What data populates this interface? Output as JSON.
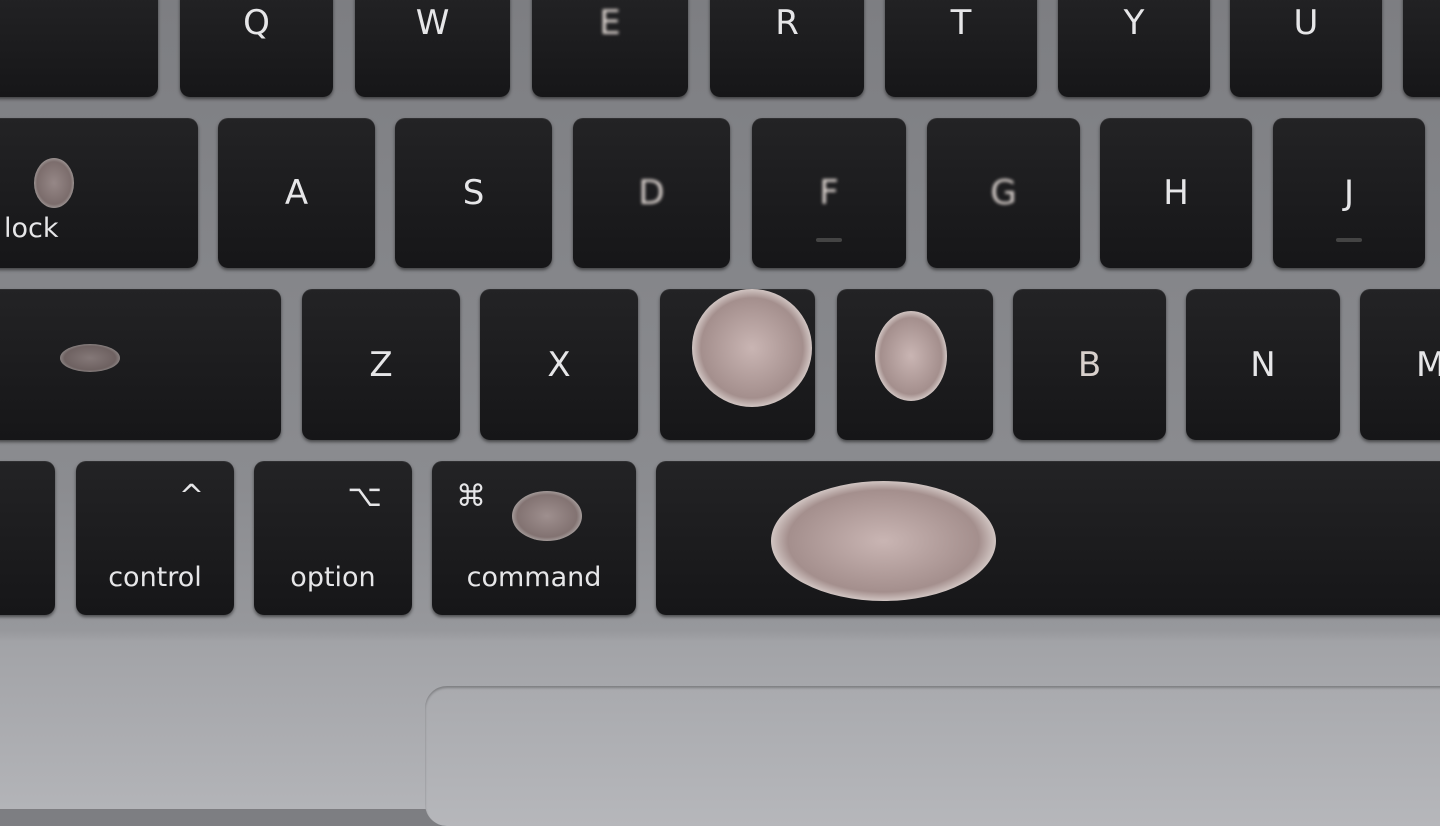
{
  "keyboard": {
    "row1": [
      "",
      "Q",
      "W",
      "E",
      "R",
      "T",
      "Y",
      "U",
      ""
    ],
    "row2": {
      "caps_lock": "lock",
      "keys": [
        "A",
        "S",
        "D",
        "F",
        "G",
        "H",
        "J"
      ]
    },
    "row3": [
      "",
      "Z",
      "X",
      "",
      "",
      "B",
      "N",
      "M"
    ],
    "row4": {
      "control": {
        "symbol": "^",
        "label": "control"
      },
      "option": {
        "symbol": "⌥",
        "label": "option"
      },
      "command": {
        "symbol": "⌘",
        "label": "command"
      }
    }
  },
  "colors": {
    "keycap": "#1a1a1c",
    "chassis": "#8a8b8f",
    "legend": "#e6e6e8"
  }
}
